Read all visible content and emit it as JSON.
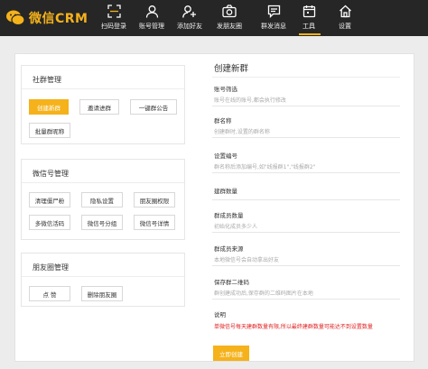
{
  "app": {
    "logo_text": "微信CRM",
    "accent": "#f5b21b"
  },
  "nav": {
    "items": [
      {
        "label": "扫码登录",
        "icon": "qr-scan-icon"
      },
      {
        "label": "账号管理",
        "icon": "user-icon"
      },
      {
        "label": "添加好友",
        "icon": "add-user-icon"
      },
      {
        "label": "发朋友圈",
        "icon": "camera-icon"
      },
      {
        "label": "群发消息",
        "icon": "message-icon"
      },
      {
        "label": "工具",
        "icon": "calendar-icon"
      },
      {
        "label": "设置",
        "icon": "home-icon"
      }
    ],
    "active": "工具"
  },
  "community": {
    "title": "社群管理",
    "buttons": [
      "创建新群",
      "邀请进群",
      "一键群公告",
      "批量群昵称"
    ]
  },
  "wechat": {
    "title": "微信号管理",
    "buttons": [
      "清理僵尸粉",
      "隐私设置",
      "朋友圈权限",
      "多微信活码",
      "微信号分组",
      "微信号详情"
    ]
  },
  "moments": {
    "title": "朋友圈管理",
    "buttons": [
      "点 赞",
      "删除朋友圈"
    ]
  },
  "form": {
    "title": "创建新群",
    "fields": [
      {
        "label": "账号筛选",
        "hint": "账号在线的账号,都会执行修改"
      },
      {
        "label": "群名称",
        "hint": "创建群时,设置的群名称"
      },
      {
        "label": "设置编号",
        "hint": "群名称后添加编号,如\"线报群1\",\"线报群2\""
      },
      {
        "label": "建群数量",
        "hint": ""
      },
      {
        "label": "群成员数量",
        "hint": "初始化成员多少人"
      },
      {
        "label": "群成员来源",
        "hint": "本地微信号会自动拿出好友"
      },
      {
        "label": "保存群二维码",
        "hint": "群创建成功后,保存群的二维码图片在本地"
      }
    ],
    "note_label": "说明",
    "note_text": "单微信号每天建群数量有限,所以最终建群数量可能达不到设置数量",
    "submit": "立即创建"
  }
}
